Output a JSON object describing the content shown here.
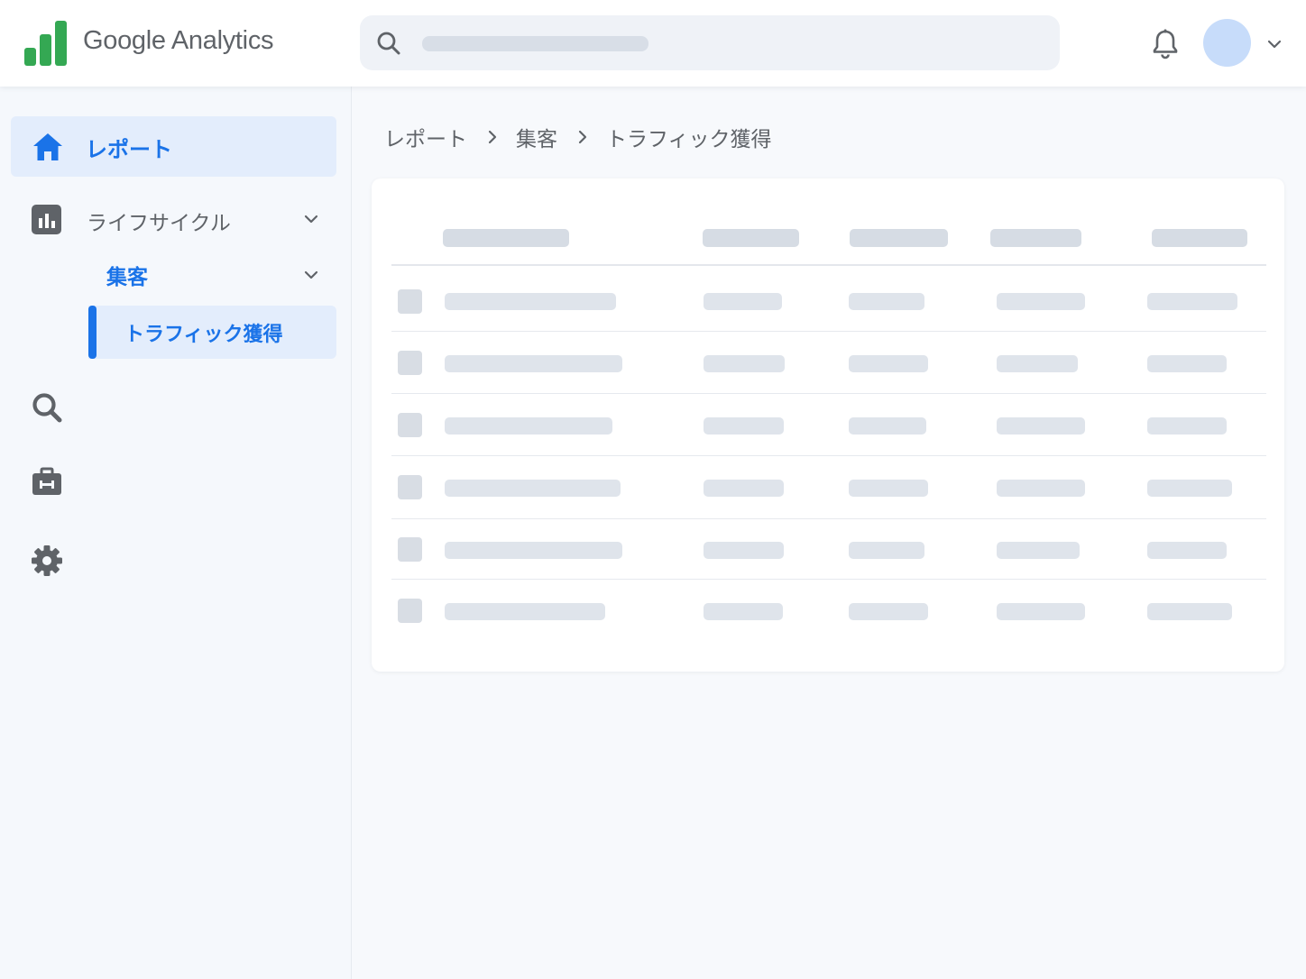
{
  "app": {
    "brand": "Google Analytics"
  },
  "colors": {
    "accent": "#1a73e8",
    "logo_green": "#34a853",
    "icon_gray": "#5f6368",
    "active_bg": "#e3edfc",
    "avatar": "#c7dcfa"
  },
  "header": {
    "search": {
      "placeholder": ""
    },
    "icons": [
      "search-icon",
      "bell-icon",
      "avatar",
      "chevron-down-icon"
    ]
  },
  "sidebar": {
    "items": [
      {
        "label": "レポート",
        "icon": "home-icon",
        "active": true
      },
      {
        "label": "ライフサイクル",
        "icon": "bar-chart-icon",
        "expanded": true
      },
      {
        "label": "集客",
        "expanded": true
      },
      {
        "label": "トラフィック獲得",
        "selected": true
      }
    ],
    "icon_items": [
      "search-icon",
      "briefcase-icon",
      "gear-icon"
    ]
  },
  "breadcrumb": {
    "items": [
      "レポート",
      "集客",
      "トラフィック獲得"
    ]
  },
  "table": {
    "state": "loading",
    "columns": 5,
    "rows": 6
  }
}
